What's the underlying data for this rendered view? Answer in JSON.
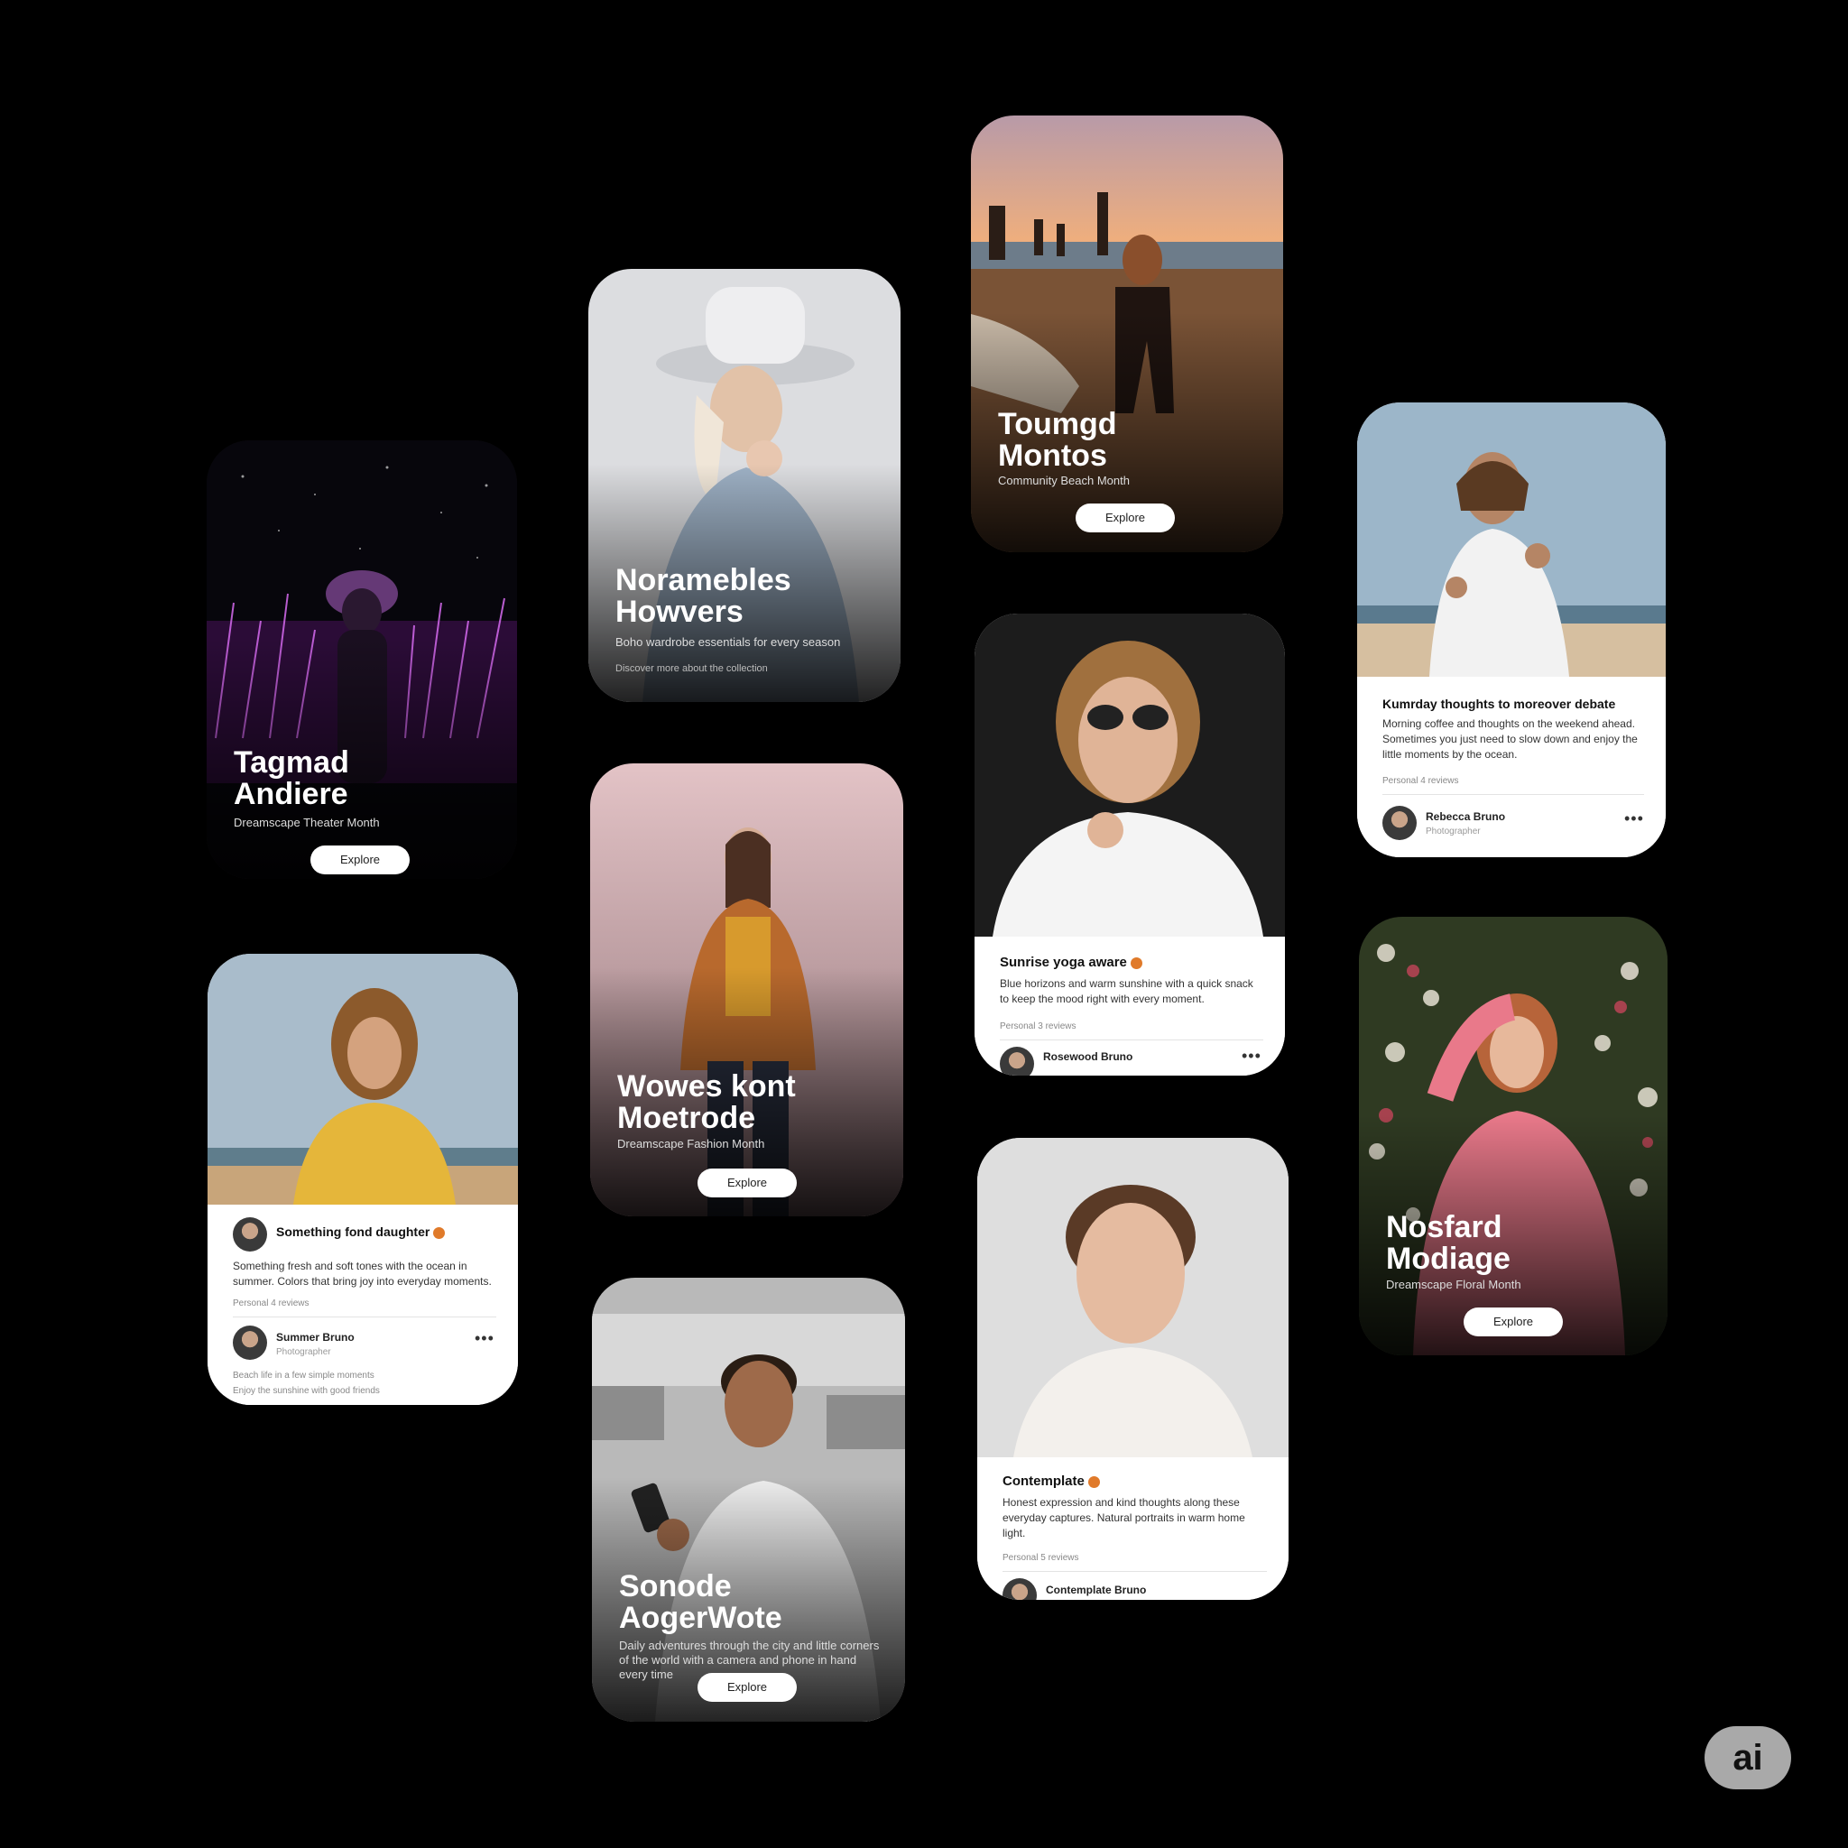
{
  "cards": {
    "c1": {
      "title1": "Tagmad",
      "title2": "Andiere",
      "sub": "Dreamscape Theater Month",
      "button": "Explore"
    },
    "c2": {
      "title1": "Noramebles",
      "title2": "Howvers",
      "sub": "Boho wardrobe essentials for every season",
      "sub2": "Discover more about the collection"
    },
    "c3": {
      "title1": "Toumgd",
      "title2": "Montos",
      "sub": "Community Beach Month",
      "button": "Explore"
    },
    "c4": {
      "ptitle": "Kumrday thoughts to moreover debate",
      "pbody": "Morning coffee and thoughts on the weekend ahead. Sometimes you just need to slow down and enjoy the little moments by the ocean.",
      "pmeta": "Personal 4 reviews",
      "author": "Rebecca Bruno",
      "author_sub": "Photographer",
      "more": "•••"
    },
    "c5": {
      "title1": "Wowes kont",
      "title2": "Moetrode",
      "sub": "Dreamscape Fashion Month",
      "button": "Explore"
    },
    "c6": {
      "ptitle": "Sunrise yoga aware",
      "pbody": "Blue horizons and warm sunshine with a quick snack to keep the mood right with every moment.",
      "pmeta": "Personal 3 reviews",
      "author": "Rosewood Bruno",
      "more": "•••"
    },
    "c7": {
      "ptitle": "Something fond daughter",
      "pbody": "Something fresh and soft tones with the ocean in summer. Colors that bring joy into everyday moments.",
      "pmeta": "Personal 4 reviews",
      "author": "Summer Bruno",
      "author_sub": "Photographer",
      "more": "•••",
      "foot1": "Beach life in a few simple moments",
      "foot2": "Enjoy the sunshine with good friends"
    },
    "c8": {
      "ptitle": "Contemplate",
      "pbody": "Honest expression and kind thoughts along these everyday captures. Natural portraits in warm home light.",
      "pmeta": "Personal 5 reviews",
      "author": "Contemplate Bruno"
    },
    "c9": {
      "title1": "Nosfard",
      "title2": "Modiage",
      "sub": "Dreamscape Floral Month",
      "button": "Explore"
    },
    "c10": {
      "title1": "Sonode",
      "title2": "AogerWote",
      "sub": "Daily adventures through the city and little corners of the world with a camera and phone in hand every time",
      "button": "Explore"
    }
  },
  "badge": "ai",
  "colors": {
    "background": "#000000",
    "badge": "#a9a9a9"
  }
}
